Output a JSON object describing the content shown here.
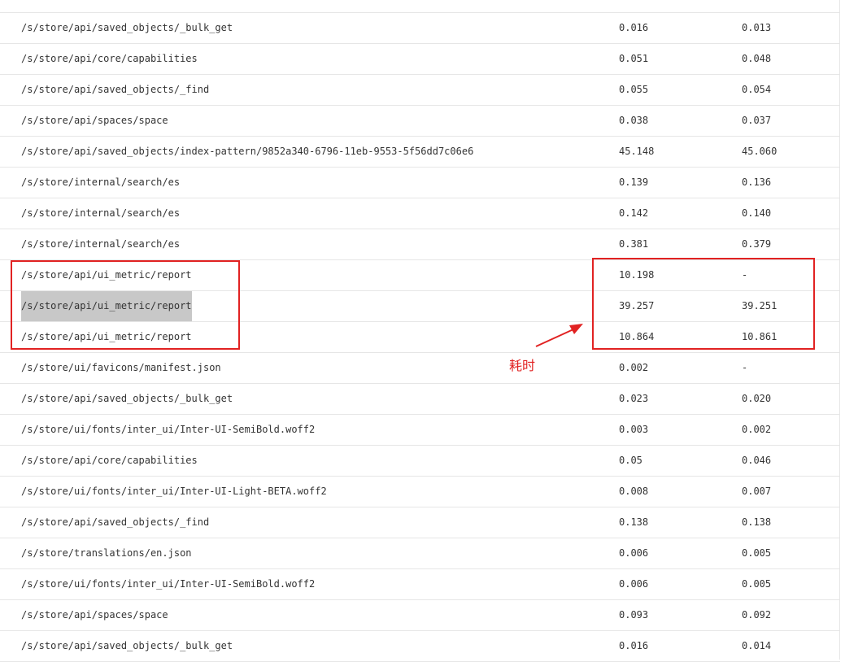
{
  "rows": [
    {
      "url": "/s/store/api/saved_objects/_bulk_get",
      "v1": "0.016",
      "v2": "0.013"
    },
    {
      "url": "/s/store/api/core/capabilities",
      "v1": "0.051",
      "v2": "0.048"
    },
    {
      "url": "/s/store/api/saved_objects/_find",
      "v1": "0.055",
      "v2": "0.054"
    },
    {
      "url": "/s/store/api/spaces/space",
      "v1": "0.038",
      "v2": "0.037"
    },
    {
      "url": "/s/store/api/saved_objects/index-pattern/9852a340-6796-11eb-9553-5f56dd7c06e6",
      "v1": "45.148",
      "v2": "45.060"
    },
    {
      "url": "/s/store/internal/search/es",
      "v1": "0.139",
      "v2": "0.136"
    },
    {
      "url": "/s/store/internal/search/es",
      "v1": "0.142",
      "v2": "0.140"
    },
    {
      "url": "/s/store/internal/search/es",
      "v1": "0.381",
      "v2": "0.379"
    },
    {
      "url": "/s/store/api/ui_metric/report",
      "v1": "10.198",
      "v2": "-"
    },
    {
      "url": "/s/store/api/ui_metric/report",
      "v1": "39.257",
      "v2": "39.251"
    },
    {
      "url": "/s/store/api/ui_metric/report",
      "v1": "10.864",
      "v2": "10.861"
    },
    {
      "url": "/s/store/ui/favicons/manifest.json",
      "v1": "0.002",
      "v2": "-"
    },
    {
      "url": "/s/store/api/saved_objects/_bulk_get",
      "v1": "0.023",
      "v2": "0.020"
    },
    {
      "url": "/s/store/ui/fonts/inter_ui/Inter-UI-SemiBold.woff2",
      "v1": "0.003",
      "v2": "0.002"
    },
    {
      "url": "/s/store/api/core/capabilities",
      "v1": "0.05",
      "v2": "0.046"
    },
    {
      "url": "/s/store/ui/fonts/inter_ui/Inter-UI-Light-BETA.woff2",
      "v1": "0.008",
      "v2": "0.007"
    },
    {
      "url": "/s/store/api/saved_objects/_find",
      "v1": "0.138",
      "v2": "0.138"
    },
    {
      "url": "/s/store/translations/en.json",
      "v1": "0.006",
      "v2": "0.005"
    },
    {
      "url": "/s/store/ui/fonts/inter_ui/Inter-UI-SemiBold.woff2",
      "v1": "0.006",
      "v2": "0.005"
    },
    {
      "url": "/s/store/api/spaces/space",
      "v1": "0.093",
      "v2": "0.092"
    },
    {
      "url": "/s/store/api/saved_objects/_bulk_get",
      "v1": "0.016",
      "v2": "0.014"
    }
  ],
  "annotation": {
    "text": "耗时"
  },
  "colors": {
    "highlight_box": "#e12222",
    "selection": "#c8c8c8"
  }
}
